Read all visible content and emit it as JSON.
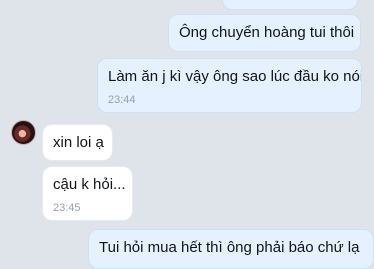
{
  "messages": [
    {
      "text": ""
    },
    {
      "text": "Ông chuyển hoàng tui thôi"
    },
    {
      "text": "Làm ăn j kì vậy ông sao lúc đầu ko nói",
      "time": "23:44"
    },
    {
      "text": "xin loi ạ"
    },
    {
      "text": "cậu k hỏi...",
      "time": "23:45"
    },
    {
      "text": "Tui hỏi mua hết thì ông phải báo chứ lạ"
    }
  ]
}
